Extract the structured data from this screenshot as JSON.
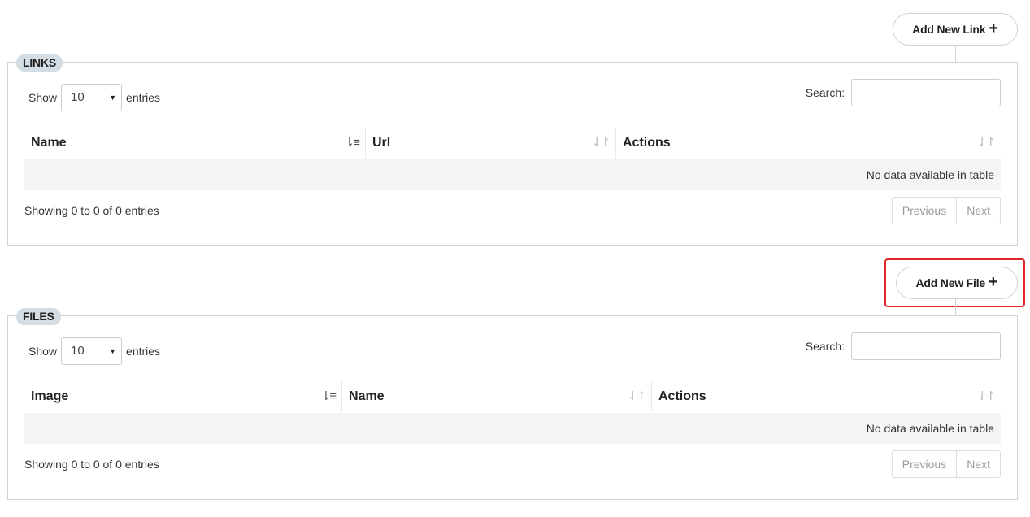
{
  "links": {
    "add_button_label": "Add New Link",
    "add_button_icon": "plus-icon",
    "legend": "LINKS",
    "show_label": "Show",
    "show_value": "10",
    "entries_label": "entries",
    "search_label": "Search:",
    "search_value": "",
    "columns": [
      "Name",
      "Url",
      "Actions"
    ],
    "empty_message": "No data available in table",
    "info": "Showing 0 to 0 of 0 entries",
    "prev_label": "Previous",
    "next_label": "Next"
  },
  "files": {
    "add_button_label": "Add New File",
    "add_button_icon": "plus-icon",
    "legend": "FILES",
    "show_label": "Show",
    "show_value": "10",
    "entries_label": "entries",
    "search_label": "Search:",
    "search_value": "",
    "columns": [
      "Image",
      "Name",
      "Actions"
    ],
    "empty_message": "No data available in table",
    "info": "Showing 0 to 0 of 0 entries",
    "prev_label": "Previous",
    "next_label": "Next"
  },
  "highlight_color": "#e0242a",
  "legend_bg": "#d3dde3"
}
